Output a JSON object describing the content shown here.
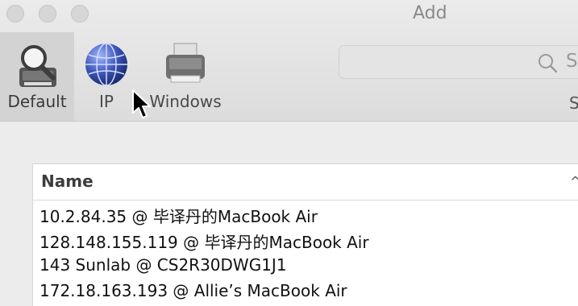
{
  "window": {
    "title": "Add"
  },
  "toolbar": {
    "buttons": [
      {
        "label": "Default",
        "icon": "default-printer-icon",
        "active": true
      },
      {
        "label": "IP",
        "icon": "globe-icon",
        "active": false
      },
      {
        "label": "Windows",
        "icon": "windows-printer-icon",
        "active": false
      }
    ],
    "search": {
      "placeholder_visible": "S",
      "label_visible": "S"
    }
  },
  "table": {
    "header": {
      "name": "Name",
      "sort_indicator": "^"
    },
    "rows": [
      "10.2.84.35 @ 毕译丹的MacBook Air",
      "128.148.155.119 @ 毕译丹的MacBook Air",
      "143 Sunlab @ CS2R30DWG1J1",
      "172.18.163.193 @ Allie’s MacBook Air"
    ]
  }
}
